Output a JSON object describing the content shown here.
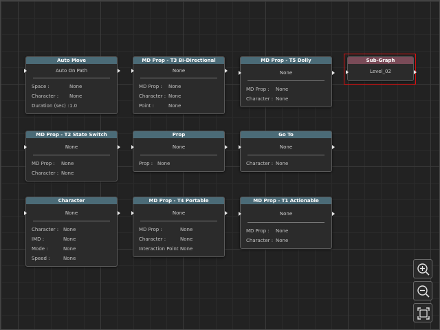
{
  "nodes": {
    "auto_move": {
      "title": "Auto Move",
      "value": "Auto On Path",
      "fields": [
        {
          "label": "Space :",
          "value": "None"
        },
        {
          "label": "Character :",
          "value": "None"
        },
        {
          "label": "Duration (sec) :",
          "value": "1.0"
        }
      ]
    },
    "t3": {
      "title": "MD Prop - T3 Bi-Directional",
      "value": "None",
      "fields": [
        {
          "label": "MD Prop :",
          "value": "None"
        },
        {
          "label": "Character :",
          "value": "None"
        },
        {
          "label": "Point :",
          "value": "None"
        }
      ]
    },
    "t5": {
      "title": "MD Prop - T5 Dolly",
      "value": "None",
      "fields": [
        {
          "label": "MD Prop :",
          "value": "None"
        },
        {
          "label": "Character :",
          "value": "None"
        }
      ]
    },
    "subgraph": {
      "title": "Sub-Graph",
      "value": "Level_02"
    },
    "t2": {
      "title": "MD Prop - T2 State Switch",
      "value": "None",
      "fields": [
        {
          "label": "MD Prop :",
          "value": "None"
        },
        {
          "label": "Character :",
          "value": "None"
        }
      ]
    },
    "prop": {
      "title": "Prop",
      "value": "None",
      "fields": [
        {
          "label": "Prop :",
          "value": "None"
        }
      ]
    },
    "goto": {
      "title": "Go To",
      "value": "None",
      "fields": [
        {
          "label": "Character :",
          "value": "None"
        }
      ]
    },
    "character": {
      "title": "Character",
      "value": "None",
      "fields": [
        {
          "label": "Character :",
          "value": "None"
        },
        {
          "label": "IMD :",
          "value": "None"
        },
        {
          "label": "Mode :",
          "value": "None"
        },
        {
          "label": "Speed :",
          "value": "None"
        }
      ]
    },
    "t4": {
      "title": "MD Prop - T4 Portable",
      "value": "None",
      "fields": [
        {
          "label": "MD Prop :",
          "value": "None"
        },
        {
          "label": "Character :",
          "value": "None"
        },
        {
          "label": "Interaction Point :",
          "value": "None"
        }
      ]
    },
    "t1": {
      "title": "MD Prop - T1 Actionable",
      "value": "None",
      "fields": [
        {
          "label": "MD Prop :",
          "value": "None"
        },
        {
          "label": "Character :",
          "value": "None"
        }
      ]
    }
  },
  "toolbar": {
    "zoom_in_icon": "zoom-in-icon",
    "zoom_out_icon": "zoom-out-icon",
    "fit_icon": "fit-view-icon"
  },
  "colors": {
    "header": "#4b6b77",
    "subgraph_header": "#7a4b58",
    "selection": "#e01010",
    "background": "#222222"
  }
}
